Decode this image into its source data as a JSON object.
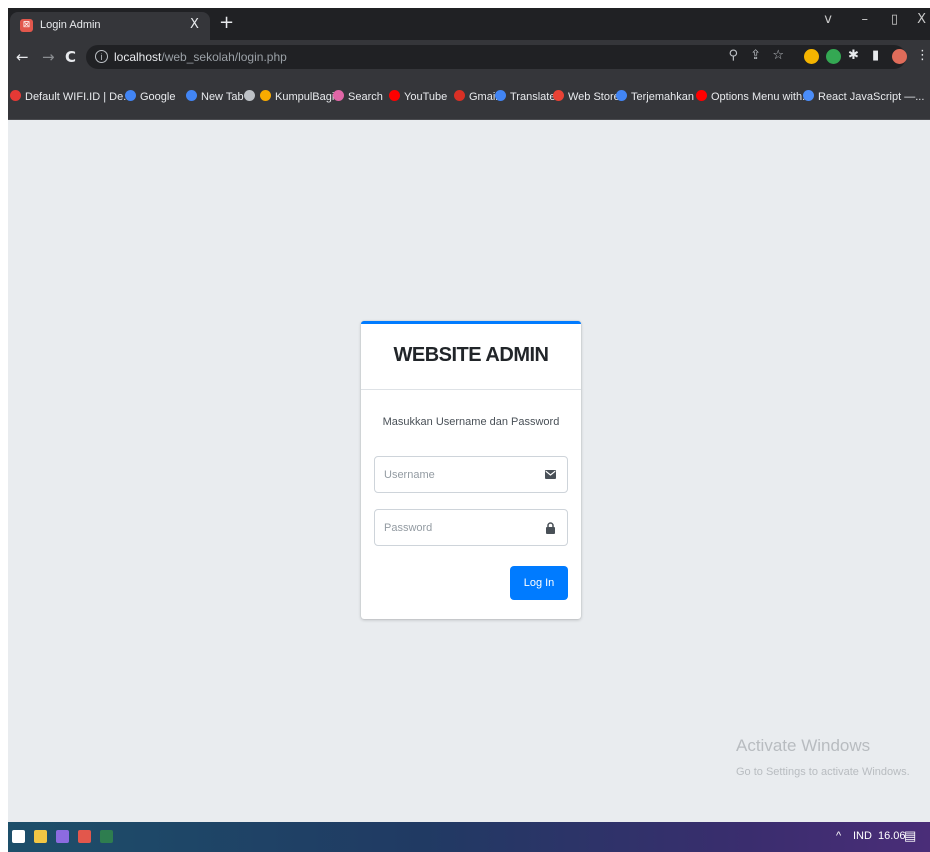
{
  "browser": {
    "tab": {
      "title": "Login Admin",
      "close": "X"
    },
    "new_tab": "+",
    "window_controls": {
      "chevron": "v",
      "minimize": "–",
      "restore": "▯",
      "close": "X"
    },
    "nav": {
      "back": "←",
      "forward": "→",
      "reload": "C"
    },
    "url": {
      "host": "localhost",
      "path": "/web_sekolah/login.php"
    },
    "bookmarks": [
      {
        "label": "Default WIFI.ID | De...",
        "icon": "wifi-icon",
        "color": "#e53935"
      },
      {
        "label": "Google",
        "icon": "google-icon",
        "color": "#4285f4"
      },
      {
        "label": "New Tab",
        "icon": "google-icon",
        "color": "#4285f4"
      },
      {
        "label": "",
        "icon": "globe-icon",
        "color": "#bdc1c6"
      },
      {
        "label": "KumpulBagi",
        "icon": "kumpulbagi-icon",
        "color": "#f9ab00"
      },
      {
        "label": "Search",
        "icon": "search-engine-icon",
        "color": "#e066a6"
      },
      {
        "label": "YouTube",
        "icon": "youtube-icon",
        "color": "#ff0000"
      },
      {
        "label": "Gmail",
        "icon": "gmail-icon",
        "color": "#d93025"
      },
      {
        "label": "Translate",
        "icon": "translate-icon",
        "color": "#4285f4"
      },
      {
        "label": "Web Store",
        "icon": "webstore-icon",
        "color": "#e94235"
      },
      {
        "label": "Terjemahkan",
        "icon": "translate-icon",
        "color": "#4285f4"
      },
      {
        "label": "Options Menu with...",
        "icon": "youtube-icon",
        "color": "#ff0000"
      },
      {
        "label": "React JavaScript —...",
        "icon": "react-icon",
        "color": "#4b8df8"
      }
    ]
  },
  "login": {
    "title": "WEBSITE ADMIN",
    "message": "Masukkan Username dan Password",
    "username_placeholder": "Username",
    "password_placeholder": "Password",
    "submit_label": "Log In",
    "accent": "#007bff"
  },
  "watermark": {
    "title": "Activate Windows",
    "subtitle": "Go to Settings to activate Windows."
  },
  "taskbar": {
    "tray_chevron": "^",
    "language": "IND",
    "time": "16.06"
  }
}
